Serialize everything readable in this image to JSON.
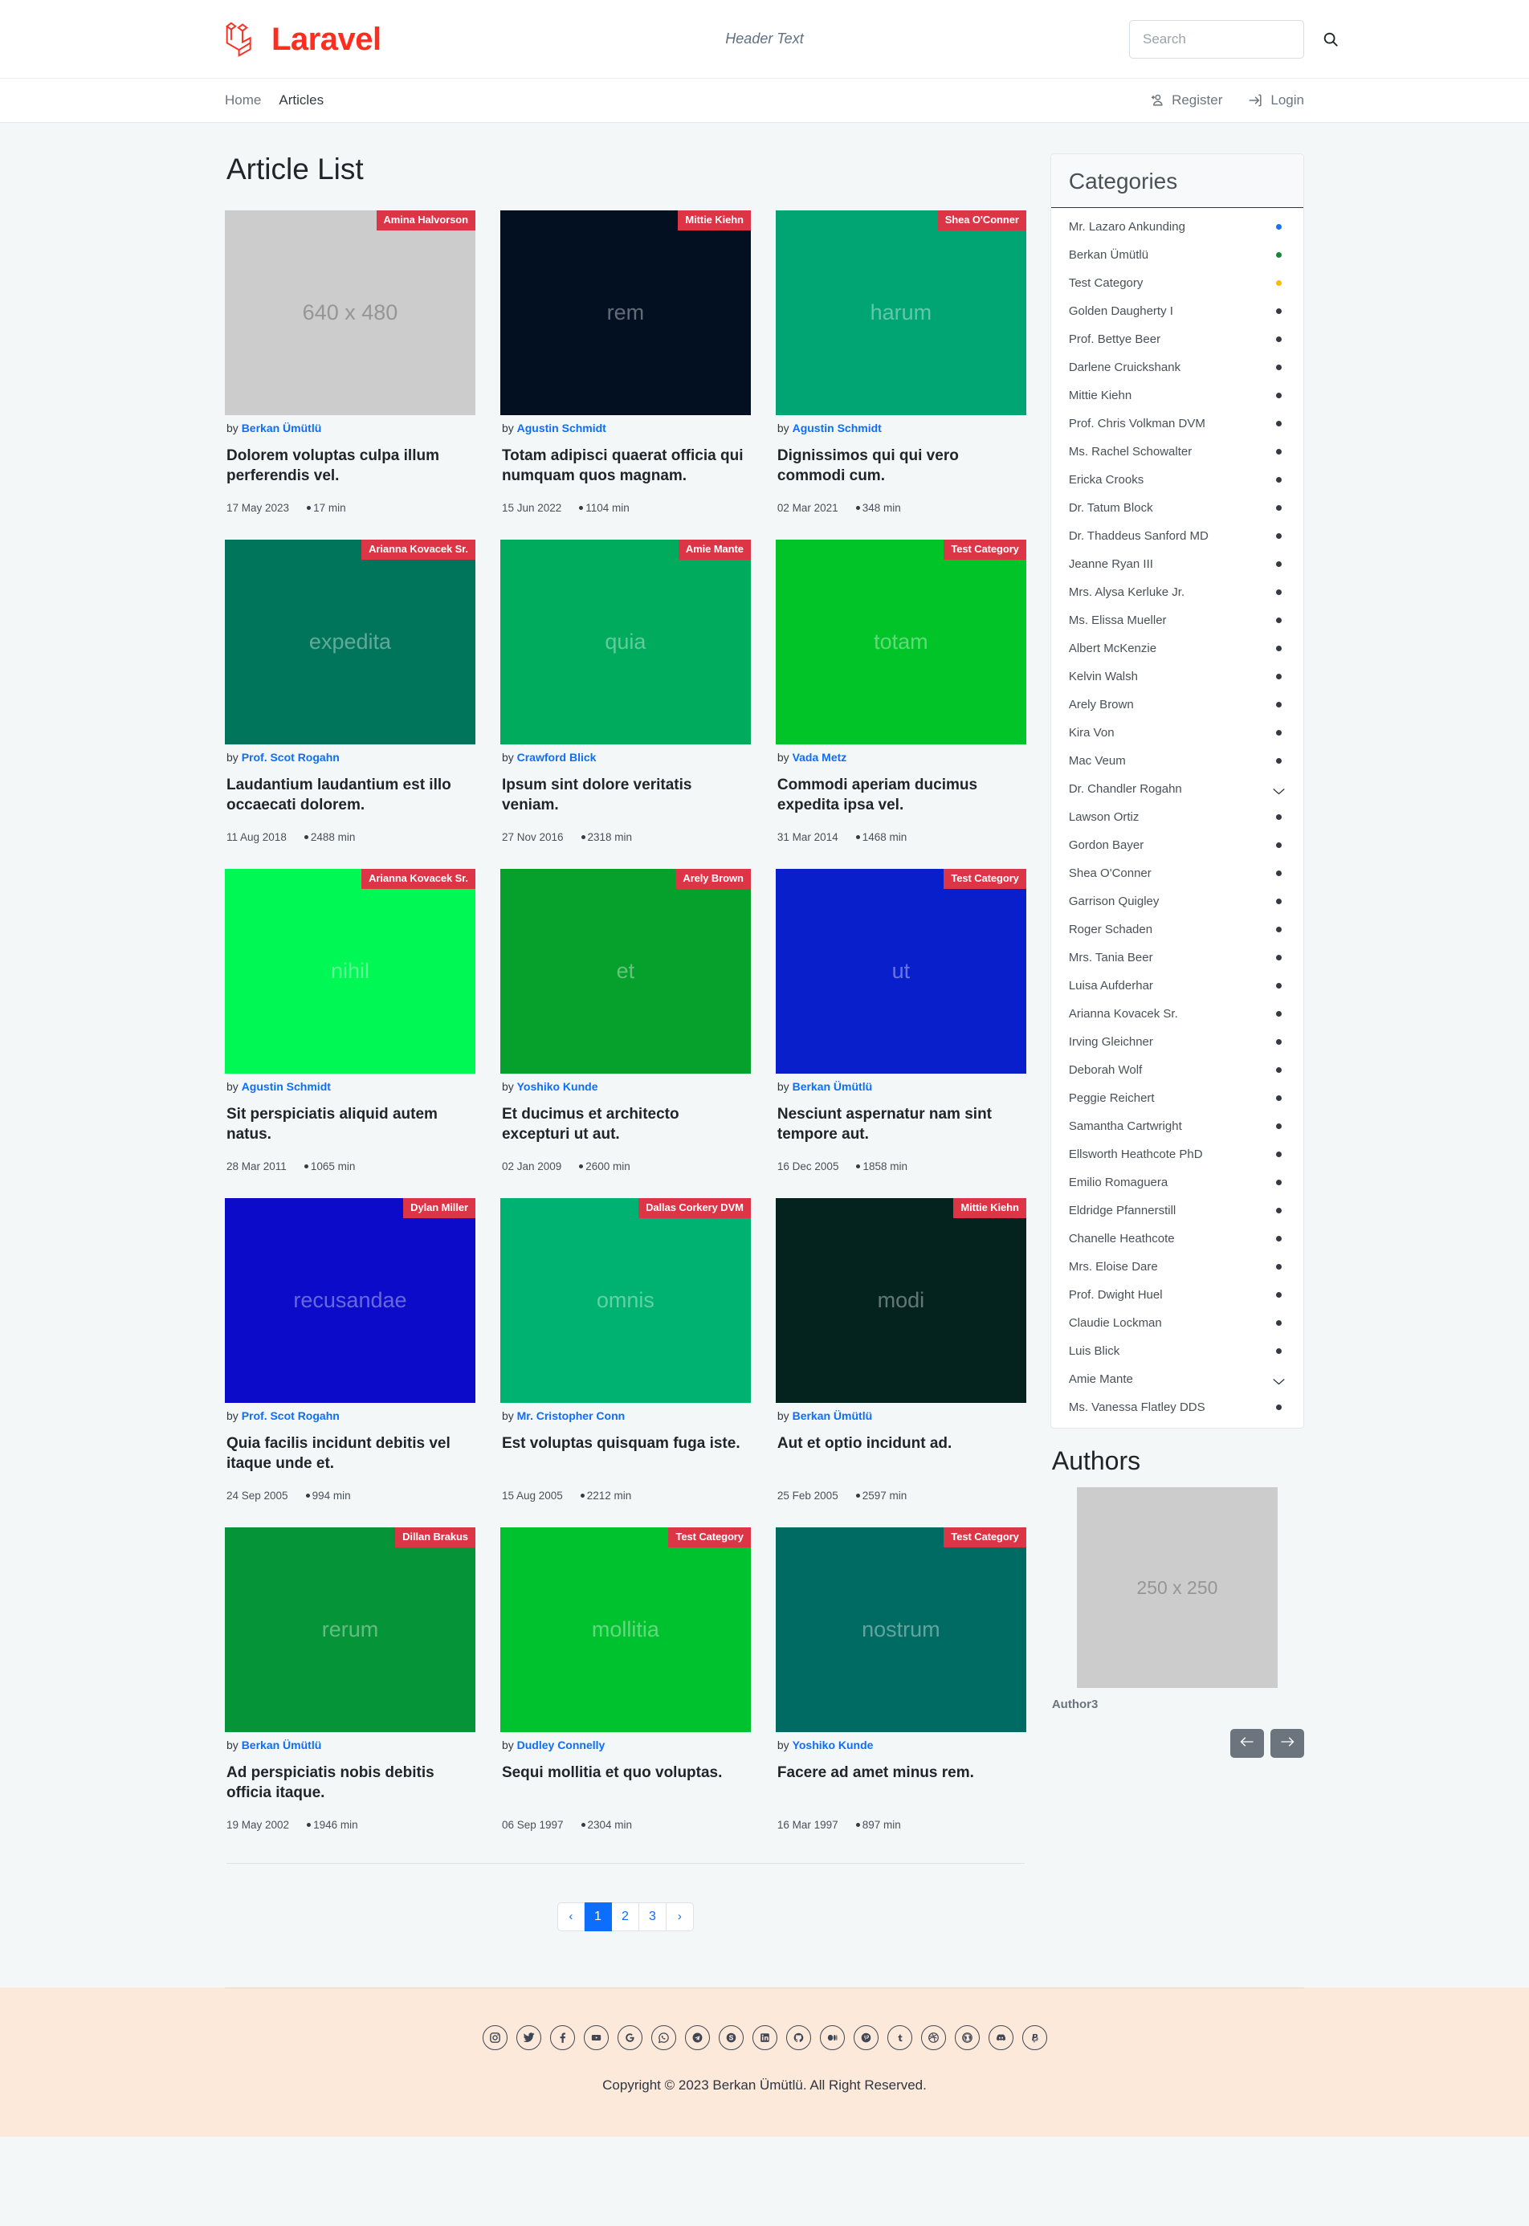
{
  "brand": {
    "name": "Laravel",
    "logo_icon": "laravel-logo-icon"
  },
  "header": {
    "header_text": "Header Text",
    "search": {
      "placeholder": "Search",
      "value": "",
      "icon": "search-icon"
    }
  },
  "nav": {
    "items": [
      {
        "label": "Home",
        "active": false
      },
      {
        "label": "Articles",
        "active": true
      }
    ],
    "auth": [
      {
        "label": "Register",
        "icon": "user-plus-icon"
      },
      {
        "label": "Login",
        "icon": "login-arrow-icon"
      }
    ]
  },
  "main": {
    "page_title": "Article List",
    "articles": [
      {
        "category": "Amina Halvorson",
        "thumb_text": "640 x 480",
        "thumb_color": "#cccccc",
        "thumb_kind": "placeholder",
        "author": "Berkan Ümütlü",
        "by_label": "by",
        "title": "Dolorem voluptas culpa illum perferendis vel.",
        "date": "17 May 2023",
        "read_time": "17 min"
      },
      {
        "category": "Mittie Kiehn",
        "thumb_text": "rem",
        "thumb_color": "#021021",
        "thumb_kind": "color",
        "author": "Agustin Schmidt",
        "by_label": "by",
        "title": "Totam adipisci quaerat officia qui numquam quos magnam.",
        "date": "15 Jun 2022",
        "read_time": "1104 min"
      },
      {
        "category": "Shea O'Conner",
        "thumb_text": "harum",
        "thumb_color": "#00a573",
        "thumb_kind": "color",
        "author": "Agustin Schmidt",
        "by_label": "by",
        "title": "Dignissimos qui qui vero commodi cum.",
        "date": "02 Mar 2021",
        "read_time": "348 min"
      },
      {
        "category": "Arianna Kovacek Sr.",
        "thumb_text": "expedita",
        "thumb_color": "#00755c",
        "thumb_kind": "color",
        "author": "Prof. Scot Rogahn",
        "by_label": "by",
        "title": "Laudantium laudantium est illo occaecati dolorem.",
        "date": "11 Aug 2018",
        "read_time": "2488 min"
      },
      {
        "category": "Amie Mante",
        "thumb_text": "quia",
        "thumb_color": "#00ab5e",
        "thumb_kind": "color",
        "author": "Crawford Blick",
        "by_label": "by",
        "title": "Ipsum sint dolore veritatis veniam.",
        "date": "27 Nov 2016",
        "read_time": "2318 min"
      },
      {
        "category": "Test Category",
        "thumb_text": "totam",
        "thumb_color": "#00c428",
        "thumb_kind": "color",
        "author": "Vada Metz",
        "by_label": "by",
        "title": "Commodi aperiam ducimus expedita ipsa vel.",
        "date": "31 Mar 2014",
        "read_time": "1468 min"
      },
      {
        "category": "Arianna Kovacek Sr.",
        "thumb_text": "nihil",
        "thumb_color": "#00f855",
        "thumb_kind": "color",
        "author": "Agustin Schmidt",
        "by_label": "by",
        "title": "Sit perspiciatis aliquid autem natus.",
        "date": "28 Mar 2011",
        "read_time": "1065 min"
      },
      {
        "category": "Arely Brown",
        "thumb_text": "et",
        "thumb_color": "#05a12c",
        "thumb_kind": "color",
        "author": "Yoshiko Kunde",
        "by_label": "by",
        "title": "Et ducimus et architecto excepturi ut aut.",
        "date": "02 Jan 2009",
        "read_time": "2600 min"
      },
      {
        "category": "Test Category",
        "thumb_text": "ut",
        "thumb_color": "#0a1fcc",
        "thumb_kind": "color",
        "author": "Berkan Ümütlü",
        "by_label": "by",
        "title": "Nesciunt aspernatur nam sint tempore aut.",
        "date": "16 Dec 2005",
        "read_time": "1858 min"
      },
      {
        "category": "Dylan Miller",
        "thumb_text": "recusandae",
        "thumb_color": "#0b0bc9",
        "thumb_kind": "color",
        "author": "Prof. Scot Rogahn",
        "by_label": "by",
        "title": "Quia facilis incidunt debitis vel itaque unde et.",
        "date": "24 Sep 2005",
        "read_time": "994 min"
      },
      {
        "category": "Dallas Corkery DVM",
        "thumb_text": "omnis",
        "thumb_color": "#00b272",
        "thumb_kind": "color",
        "author": "Mr. Cristopher Conn",
        "by_label": "by",
        "title": "Est voluptas quisquam fuga iste.",
        "date": "15 Aug 2005",
        "read_time": "2212 min"
      },
      {
        "category": "Mittie Kiehn",
        "thumb_text": "modi",
        "thumb_color": "#04231f",
        "thumb_kind": "color",
        "author": "Berkan Ümütlü",
        "by_label": "by",
        "title": "Aut et optio incidunt ad.",
        "date": "25 Feb 2005",
        "read_time": "2597 min"
      },
      {
        "category": "Dillan Brakus",
        "thumb_text": "rerum",
        "thumb_color": "#059438",
        "thumb_kind": "color",
        "author": "Berkan Ümütlü",
        "by_label": "by",
        "title": "Ad perspiciatis nobis debitis officia itaque.",
        "date": "19 May 2002",
        "read_time": "1946 min"
      },
      {
        "category": "Test Category",
        "thumb_text": "mollitia",
        "thumb_color": "#00c22e",
        "thumb_kind": "color",
        "author": "Dudley Connelly",
        "by_label": "by",
        "title": "Sequi mollitia et quo voluptas.",
        "date": "06 Sep 1997",
        "read_time": "2304 min"
      },
      {
        "category": "Test Category",
        "thumb_text": "nostrum",
        "thumb_color": "#006b62",
        "thumb_kind": "color",
        "author": "Yoshiko Kunde",
        "by_label": "by",
        "title": "Facere ad amet minus rem.",
        "date": "16 Mar 1997",
        "read_time": "897 min"
      }
    ],
    "pagination": {
      "prev_label": "‹",
      "next_label": "›",
      "pages": [
        "1",
        "2",
        "3"
      ],
      "current": "1"
    }
  },
  "sidebar": {
    "categories_title": "Categories",
    "categories": [
      {
        "label": "Mr. Lazaro Ankunding",
        "marker": "dot",
        "color": "#1a73e8"
      },
      {
        "label": "Berkan Ümütlü",
        "marker": "dot",
        "color": "#128a35"
      },
      {
        "label": "Test Category",
        "marker": "dot",
        "color": "#fbbc04"
      },
      {
        "label": "Golden Daugherty I",
        "marker": "dot",
        "color": "#343a40"
      },
      {
        "label": "Prof. Bettye Beer",
        "marker": "dot",
        "color": "#343a40"
      },
      {
        "label": "Darlene Cruickshank",
        "marker": "dot",
        "color": "#343a40"
      },
      {
        "label": "Mittie Kiehn",
        "marker": "dot",
        "color": "#343a40"
      },
      {
        "label": "Prof. Chris Volkman DVM",
        "marker": "dot",
        "color": "#343a40"
      },
      {
        "label": "Ms. Rachel Schowalter",
        "marker": "dot",
        "color": "#343a40"
      },
      {
        "label": "Ericka Crooks",
        "marker": "dot",
        "color": "#343a40"
      },
      {
        "label": "Dr. Tatum Block",
        "marker": "dot",
        "color": "#343a40"
      },
      {
        "label": "Dr. Thaddeus Sanford MD",
        "marker": "dot",
        "color": "#343a40"
      },
      {
        "label": "Jeanne Ryan III",
        "marker": "dot",
        "color": "#343a40"
      },
      {
        "label": "Mrs. Alysa Kerluke Jr.",
        "marker": "dot",
        "color": "#343a40"
      },
      {
        "label": "Ms. Elissa Mueller",
        "marker": "dot",
        "color": "#343a40"
      },
      {
        "label": "Albert McKenzie",
        "marker": "dot",
        "color": "#343a40"
      },
      {
        "label": "Kelvin Walsh",
        "marker": "dot",
        "color": "#343a40"
      },
      {
        "label": "Arely Brown",
        "marker": "dot",
        "color": "#343a40"
      },
      {
        "label": "Kira Von",
        "marker": "dot",
        "color": "#343a40"
      },
      {
        "label": "Mac Veum",
        "marker": "dot",
        "color": "#343a40"
      },
      {
        "label": "Dr. Chandler Rogahn",
        "marker": "chevron",
        "color": "#343a40"
      },
      {
        "label": "Lawson Ortiz",
        "marker": "dot",
        "color": "#343a40"
      },
      {
        "label": "Gordon Bayer",
        "marker": "dot",
        "color": "#343a40"
      },
      {
        "label": "Shea O'Conner",
        "marker": "dot",
        "color": "#343a40"
      },
      {
        "label": "Garrison Quigley",
        "marker": "dot",
        "color": "#343a40"
      },
      {
        "label": "Roger Schaden",
        "marker": "dot",
        "color": "#343a40"
      },
      {
        "label": "Mrs. Tania Beer",
        "marker": "dot",
        "color": "#343a40"
      },
      {
        "label": "Luisa Aufderhar",
        "marker": "dot",
        "color": "#343a40"
      },
      {
        "label": "Arianna Kovacek Sr.",
        "marker": "dot",
        "color": "#343a40"
      },
      {
        "label": "Irving Gleichner",
        "marker": "dot",
        "color": "#343a40"
      },
      {
        "label": "Deborah Wolf",
        "marker": "dot",
        "color": "#343a40"
      },
      {
        "label": "Peggie Reichert",
        "marker": "dot",
        "color": "#343a40"
      },
      {
        "label": "Samantha Cartwright",
        "marker": "dot",
        "color": "#343a40"
      },
      {
        "label": "Ellsworth Heathcote PhD",
        "marker": "dot",
        "color": "#343a40"
      },
      {
        "label": "Emilio Romaguera",
        "marker": "dot",
        "color": "#343a40"
      },
      {
        "label": "Eldridge Pfannerstill",
        "marker": "dot",
        "color": "#343a40"
      },
      {
        "label": "Chanelle Heathcote",
        "marker": "dot",
        "color": "#343a40"
      },
      {
        "label": "Mrs. Eloise Dare",
        "marker": "dot",
        "color": "#343a40"
      },
      {
        "label": "Prof. Dwight Huel",
        "marker": "dot",
        "color": "#343a40"
      },
      {
        "label": "Claudie Lockman",
        "marker": "dot",
        "color": "#343a40"
      },
      {
        "label": "Luis Blick",
        "marker": "dot",
        "color": "#343a40"
      },
      {
        "label": "Amie Mante",
        "marker": "chevron",
        "color": "#343a40"
      },
      {
        "label": "Ms. Vanessa Flatley DDS",
        "marker": "dot",
        "color": "#343a40"
      }
    ],
    "authors_title": "Authors",
    "author": {
      "thumb_text": "250 x 250",
      "name": "Author3"
    },
    "author_nav": {
      "prev_icon": "arrow-left-icon",
      "next_icon": "arrow-right-icon"
    }
  },
  "footer": {
    "social": [
      "instagram-icon",
      "twitter-icon",
      "facebook-icon",
      "youtube-icon",
      "google-icon",
      "whatsapp-icon",
      "telegram-icon",
      "skype-icon",
      "linkedin-icon",
      "github-icon",
      "medium-icon",
      "pinterest-icon",
      "tumblr-icon",
      "dribbble-icon",
      "wordpress-icon",
      "discord-icon",
      "paypal-icon"
    ],
    "copyright": "Copyright © 2023 Berkan Ümütlü. All Right Reserved."
  },
  "colors": {
    "brand_red": "#ff2d20",
    "badge_red": "#dc3545",
    "link_blue": "#0d6efd",
    "page_bg": "#f4f7f8",
    "footer_bg": "#fce9da"
  }
}
